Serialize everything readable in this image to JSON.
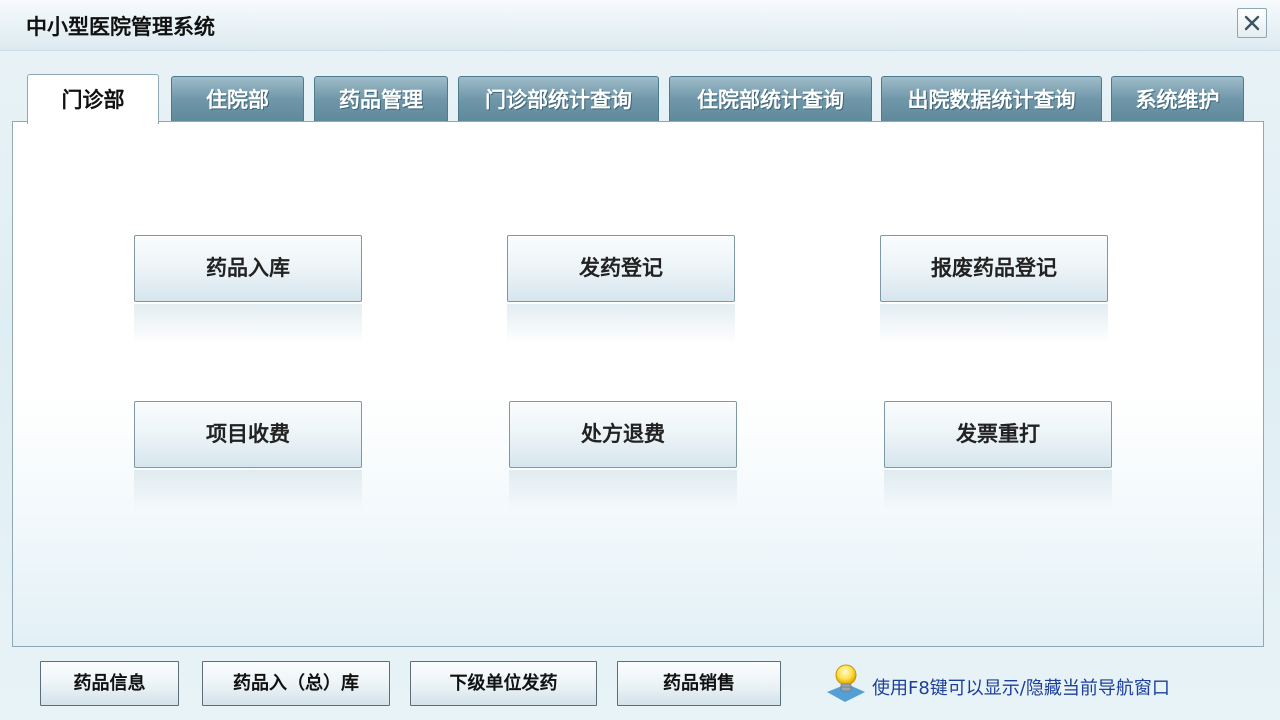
{
  "window": {
    "title": "中小型医院管理系统"
  },
  "tabs": [
    {
      "label": "门诊部",
      "active": true
    },
    {
      "label": "住院部"
    },
    {
      "label": "药品管理"
    },
    {
      "label": "门诊部统计查询"
    },
    {
      "label": "住院部统计查询"
    },
    {
      "label": "出院数据统计查询"
    },
    {
      "label": "系统维护"
    }
  ],
  "functions": [
    {
      "label": "药品入库"
    },
    {
      "label": "发药登记"
    },
    {
      "label": "报废药品登记"
    },
    {
      "label": "项目收费"
    },
    {
      "label": "处方退费"
    },
    {
      "label": "发票重打"
    }
  ],
  "bottom_buttons": [
    {
      "label": "药品信息"
    },
    {
      "label": "药品入（总）库"
    },
    {
      "label": "下级单位发药"
    },
    {
      "label": "药品销售"
    }
  ],
  "hint": {
    "text": "使用F8键可以显示/隐藏当前导航窗口",
    "icon": "lightbulb-icon"
  },
  "colors": {
    "tab_inactive": "#6f97a9",
    "tab_active": "#ffffff",
    "hint_text": "#1c3f9a"
  }
}
